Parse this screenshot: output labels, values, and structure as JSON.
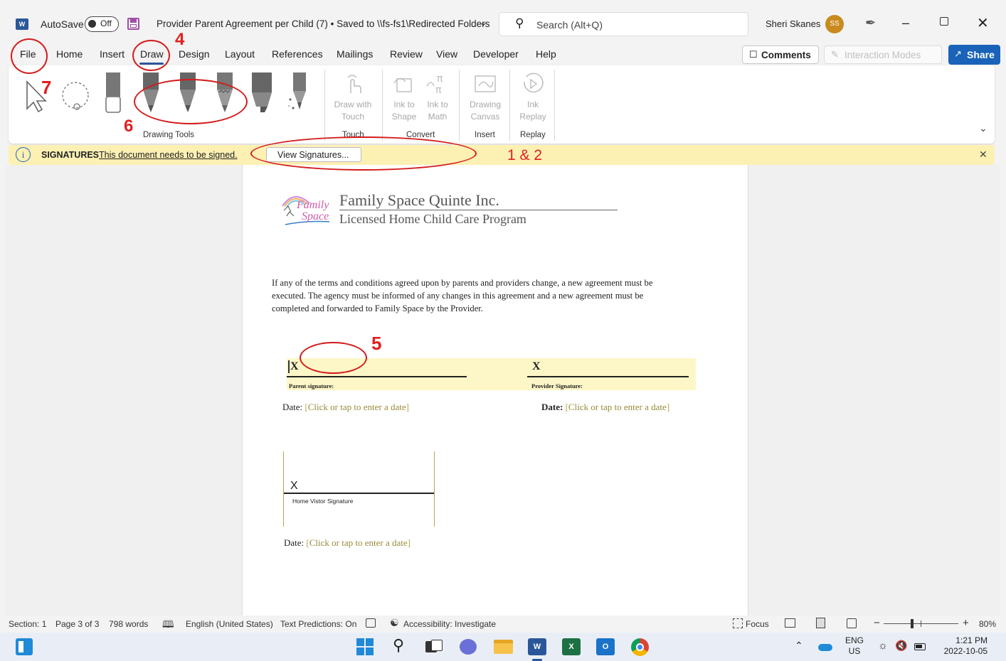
{
  "titlebar": {
    "autosave_label": "AutoSave",
    "autosave_state": "Off",
    "doc_title": "Provider Parent Agreement per Child (7) • Saved to \\\\fs-fs1\\Redirected Folders",
    "search_placeholder": "Search (Alt+Q)",
    "user_name": "Sheri Skanes",
    "user_initials": "SS"
  },
  "tabs": [
    "File",
    "Home",
    "Insert",
    "Draw",
    "Design",
    "Layout",
    "References",
    "Mailings",
    "Review",
    "View",
    "Developer",
    "Help"
  ],
  "actions": {
    "comments": "Comments",
    "interaction_modes": "Interaction Modes",
    "share": "Share"
  },
  "ribbon": {
    "groups": {
      "drawing_tools": "Drawing Tools",
      "touch": "Touch",
      "convert": "Convert",
      "insert": "Insert",
      "replay": "Replay"
    },
    "commands": {
      "draw_with_touch_1": "Draw with",
      "draw_with_touch_2": "Touch",
      "ink_to_shape_1": "Ink to",
      "ink_to_shape_2": "Shape",
      "ink_to_math_1": "Ink to",
      "ink_to_math_2": "Math",
      "drawing_canvas_1": "Drawing",
      "drawing_canvas_2": "Canvas",
      "ink_replay_1": "Ink",
      "ink_replay_2": "Replay"
    }
  },
  "infobar": {
    "title": "SIGNATURES",
    "message": "This document needs to be signed.",
    "button": "View Signatures..."
  },
  "document": {
    "logo_word1": "Family",
    "logo_word2": "Space",
    "org_name": "Family Space Quinte Inc.",
    "program": "Licensed Home Child Care Program",
    "para_line1": "If any of the terms and conditions agreed upon by parents and providers change, a new agreement must be",
    "para_line2": "executed. The agency must be informed of any changes in this agreement and a new agreement must be",
    "para_line3": "completed and forwarded to Family Space by the Provider.",
    "sig_x": "X",
    "parent_sig_label": "Parent signature:",
    "provider_sig_label": "Provider Signature:",
    "date_label": "Date:",
    "date_placeholder": "Click or tap to enter a date",
    "home_visitor_label": "Home Vistor Signature"
  },
  "annotations": {
    "a4": "4",
    "a5": "5",
    "a6": "6",
    "a7": "7",
    "a12": "1 & 2"
  },
  "status": {
    "section": "Section: 1",
    "page": "Page 3 of 3",
    "words": "798 words",
    "language": "English (United States)",
    "text_predictions": "Text Predictions: On",
    "accessibility": "Accessibility: Investigate",
    "focus": "Focus",
    "zoom": "80%"
  },
  "taskbar": {
    "lang1": "ENG",
    "lang2": "US",
    "time": "1:21 PM",
    "date": "2022-10-05"
  },
  "colors": {
    "word_blue": "#2b579a",
    "share_blue": "#1a63b8",
    "infobar_yellow": "#fdf0b3",
    "annotation_red": "#d41a1a",
    "avatar": "#c98a1e"
  }
}
